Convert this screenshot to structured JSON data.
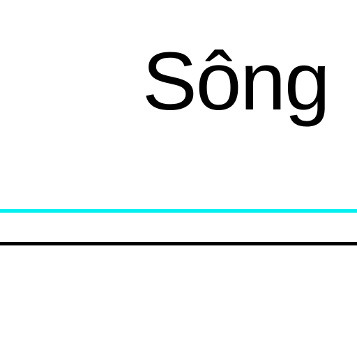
{
  "map": {
    "label": "Sông",
    "colors": {
      "background": "#ffffff",
      "label_text": "#000000",
      "cyan_line": "#00f0f0",
      "black_line": "#000000"
    }
  }
}
